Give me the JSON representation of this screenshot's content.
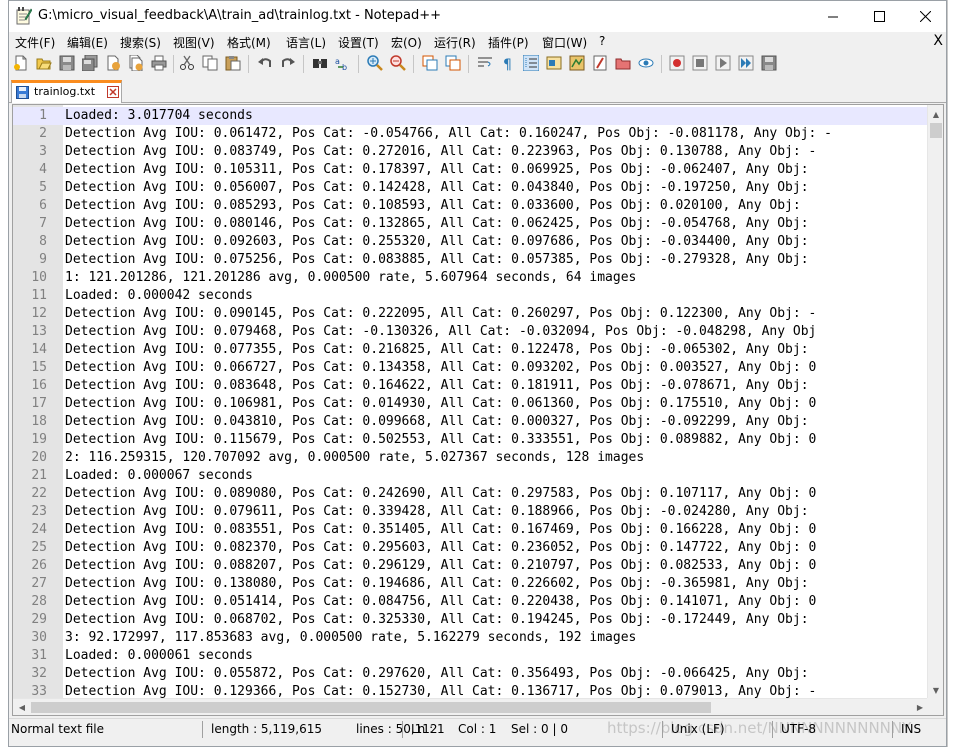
{
  "window": {
    "title": "G:\\micro_visual_feedback\\A\\train_ad\\trainlog.txt - Notepad++"
  },
  "menu": {
    "items": [
      "文件(F)",
      "编辑(E)",
      "搜索(S)",
      "视图(V)",
      "格式(M)",
      "语言(L)",
      "设置(T)",
      "宏(O)",
      "运行(R)",
      "插件(P)",
      "窗口(W)",
      "?"
    ],
    "close_doc": "X"
  },
  "tab": {
    "label": "trainlog.txt"
  },
  "editor": {
    "lines": [
      {
        "n": "1",
        "text": "Loaded: 3.017704 seconds"
      },
      {
        "n": "2",
        "text": "Detection Avg IOU: 0.061472, Pos Cat: -0.054766, All Cat: 0.160247, Pos Obj: -0.081178, Any Obj: -"
      },
      {
        "n": "3",
        "text": "Detection Avg IOU: 0.083749, Pos Cat: 0.272016, All Cat: 0.223963, Pos Obj: 0.130788, Any Obj: -"
      },
      {
        "n": "4",
        "text": "Detection Avg IOU: 0.105311, Pos Cat: 0.178397, All Cat: 0.069925, Pos Obj: -0.062407, Any Obj: "
      },
      {
        "n": "5",
        "text": "Detection Avg IOU: 0.056007, Pos Cat: 0.142428, All Cat: 0.043840, Pos Obj: -0.197250, Any Obj: "
      },
      {
        "n": "6",
        "text": "Detection Avg IOU: 0.085293, Pos Cat: 0.108593, All Cat: 0.033600, Pos Obj: 0.020100, Any Obj: "
      },
      {
        "n": "7",
        "text": "Detection Avg IOU: 0.080146, Pos Cat: 0.132865, All Cat: 0.062425, Pos Obj: -0.054768, Any Obj: "
      },
      {
        "n": "8",
        "text": "Detection Avg IOU: 0.092603, Pos Cat: 0.255320, All Cat: 0.097686, Pos Obj: -0.034400, Any Obj: "
      },
      {
        "n": "9",
        "text": "Detection Avg IOU: 0.075256, Pos Cat: 0.083885, All Cat: 0.057385, Pos Obj: -0.279328, Any Obj: "
      },
      {
        "n": "10",
        "text": "1: 121.201286, 121.201286 avg, 0.000500 rate, 5.607964 seconds, 64 images"
      },
      {
        "n": "11",
        "text": "Loaded: 0.000042 seconds"
      },
      {
        "n": "12",
        "text": "Detection Avg IOU: 0.090145, Pos Cat: 0.222095, All Cat: 0.260297, Pos Obj: 0.122300, Any Obj: -"
      },
      {
        "n": "13",
        "text": "Detection Avg IOU: 0.079468, Pos Cat: -0.130326, All Cat: -0.032094, Pos Obj: -0.048298, Any Obj"
      },
      {
        "n": "14",
        "text": "Detection Avg IOU: 0.077355, Pos Cat: 0.216825, All Cat: 0.122478, Pos Obj: -0.065302, Any Obj: "
      },
      {
        "n": "15",
        "text": "Detection Avg IOU: 0.066727, Pos Cat: 0.134358, All Cat: 0.093202, Pos Obj: 0.003527, Any Obj: 0"
      },
      {
        "n": "16",
        "text": "Detection Avg IOU: 0.083648, Pos Cat: 0.164622, All Cat: 0.181911, Pos Obj: -0.078671, Any Obj: "
      },
      {
        "n": "17",
        "text": "Detection Avg IOU: 0.106981, Pos Cat: 0.014930, All Cat: 0.061360, Pos Obj: 0.175510, Any Obj: 0"
      },
      {
        "n": "18",
        "text": "Detection Avg IOU: 0.043810, Pos Cat: 0.099668, All Cat: 0.000327, Pos Obj: -0.092299, Any Obj: "
      },
      {
        "n": "19",
        "text": "Detection Avg IOU: 0.115679, Pos Cat: 0.502553, All Cat: 0.333551, Pos Obj: 0.089882, Any Obj: 0"
      },
      {
        "n": "20",
        "text": "2: 116.259315, 120.707092 avg, 0.000500 rate, 5.027367 seconds, 128 images"
      },
      {
        "n": "21",
        "text": "Loaded: 0.000067 seconds"
      },
      {
        "n": "22",
        "text": "Detection Avg IOU: 0.089080, Pos Cat: 0.242690, All Cat: 0.297583, Pos Obj: 0.107117, Any Obj: 0"
      },
      {
        "n": "23",
        "text": "Detection Avg IOU: 0.079611, Pos Cat: 0.339428, All Cat: 0.188966, Pos Obj: -0.024280, Any Obj: "
      },
      {
        "n": "24",
        "text": "Detection Avg IOU: 0.083551, Pos Cat: 0.351405, All Cat: 0.167469, Pos Obj: 0.166228, Any Obj: 0"
      },
      {
        "n": "25",
        "text": "Detection Avg IOU: 0.082370, Pos Cat: 0.295603, All Cat: 0.236052, Pos Obj: 0.147722, Any Obj: 0"
      },
      {
        "n": "26",
        "text": "Detection Avg IOU: 0.088207, Pos Cat: 0.296129, All Cat: 0.210797, Pos Obj: 0.082533, Any Obj: 0"
      },
      {
        "n": "27",
        "text": "Detection Avg IOU: 0.138080, Pos Cat: 0.194686, All Cat: 0.226602, Pos Obj: -0.365981, Any Obj: "
      },
      {
        "n": "28",
        "text": "Detection Avg IOU: 0.051414, Pos Cat: 0.084756, All Cat: 0.220438, Pos Obj: 0.141071, Any Obj: 0"
      },
      {
        "n": "29",
        "text": "Detection Avg IOU: 0.068702, Pos Cat: 0.325330, All Cat: 0.194245, Pos Obj: -0.172449, Any Obj: "
      },
      {
        "n": "30",
        "text": "3: 92.172997, 117.853683 avg, 0.000500 rate, 5.162279 seconds, 192 images"
      },
      {
        "n": "31",
        "text": "Loaded: 0.000061 seconds"
      },
      {
        "n": "32",
        "text": "Detection Avg IOU: 0.055872, Pos Cat: 0.297620, All Cat: 0.356493, Pos Obj: -0.066425, Any Obj: "
      },
      {
        "n": "33",
        "text": "Detection Avg IOU: 0.129366, Pos Cat: 0.152730, All Cat: 0.136717, Pos Obj: 0.079013, Any Obj: -"
      }
    ]
  },
  "statusbar": {
    "file_type": "Normal text file",
    "length": "length : 5,119,615",
    "lines": "lines : 50,112",
    "ln": "Ln : 1",
    "col": "Col : 1",
    "sel": "Sel : 0 | 0",
    "eol": "Unix (LF)",
    "encoding": "UTF-8",
    "mode": "INS",
    "watermark": "https://blog.csdn.net/NNNNNNNNNNNNY"
  },
  "colors": {
    "tab_accent": "#fa8c1e",
    "current_line": "#e8e8ff",
    "gutter": "#e4e4e4"
  }
}
